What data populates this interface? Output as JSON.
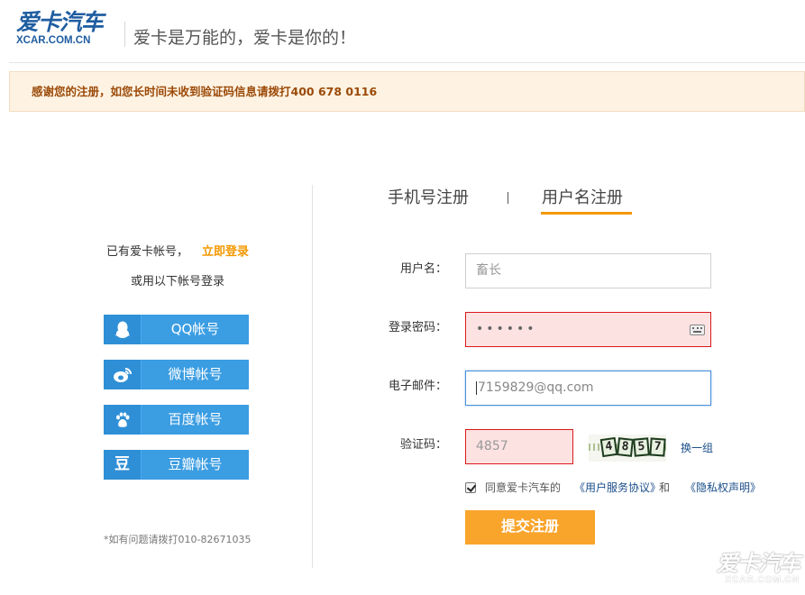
{
  "header": {
    "logo_cn": "爱卡汽车",
    "logo_en": "XCAR.COM.CN",
    "slogan": "爱卡是万能的，爱卡是你的！"
  },
  "notice": {
    "text": "感谢您的注册，如您长时间未收到验证码信息请拨打400  678  0116"
  },
  "left_panel": {
    "has_account": "已有爱卡帐号，",
    "login_now": "立即登录",
    "or_login": "或用以下帐号登录",
    "sns": [
      {
        "icon": "qq-penguin-icon",
        "glyph": "♟",
        "label": "QQ帐号",
        "color": "#3b9de2"
      },
      {
        "icon": "weibo-icon",
        "glyph": "◎",
        "label": "微博帐号",
        "color": "#3b9de2"
      },
      {
        "icon": "baidu-paw-icon",
        "glyph": "✿",
        "label": "百度帐号",
        "color": "#3b9de2"
      },
      {
        "icon": "douban-icon",
        "glyph": "豆",
        "label": "豆瓣帐号",
        "color": "#3b9de2"
      }
    ],
    "help": "*如有问题请拨打010-82671035"
  },
  "tabs": {
    "phone": "手机号注册",
    "username": "用户名注册",
    "active": "username",
    "accent_color": "#f39800"
  },
  "form": {
    "username_label": "用户名：",
    "username_value": "畜长",
    "password_label": "登录密码：",
    "password_value": "••••••",
    "email_label": "电子邮件：",
    "email_value": "7159829@qq.com",
    "captcha_label": "验证码：",
    "captcha_value": "4857",
    "captcha_image_chars": [
      "4",
      "8",
      "5",
      "7"
    ],
    "refresh_label": "换一组",
    "agree_prefix": "同意爱卡汽车的",
    "agree_link1": "《用户服务协议》",
    "agree_and": "和",
    "agree_link2": "《隐私权声明》",
    "agree_checked": true,
    "submit_label": "提交注册",
    "error_bg_color": "#fde2e2",
    "error_border_color": "#d9191c"
  },
  "watermark": {
    "cn": "爱卡汽车",
    "en": "XCAR.COM.CN"
  }
}
